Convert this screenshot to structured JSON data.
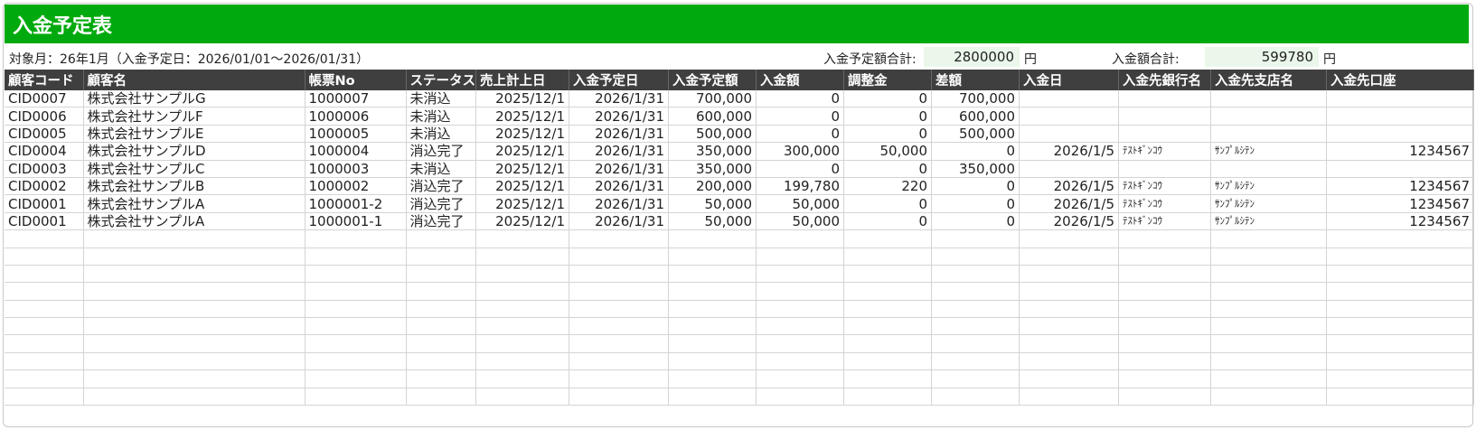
{
  "title": "入金予定表",
  "summary": {
    "period": "対象月：26年1月（入金予定日：2026/01/01～2026/01/31）",
    "planned_total_label": "入金予定額合計:",
    "planned_total_value": "2800000",
    "planned_total_unit": "円",
    "received_total_label": "入金額合計:",
    "received_total_value": "599780",
    "received_total_unit": "円"
  },
  "columns": [
    "顧客コード",
    "顧客名",
    "帳票No",
    "ステータス",
    "売上計上日",
    "入金予定日",
    "入金予定額",
    "入金額",
    "調整金",
    "差額",
    "入金日",
    "入金先銀行名",
    "入金先支店名",
    "入金先口座"
  ],
  "rows": [
    [
      "CID0007",
      "株式会社サンプルG",
      "1000007",
      "未消込",
      "2025/12/1",
      "2026/1/31",
      "700,000",
      "0",
      "0",
      "700,000",
      "",
      "",
      "",
      ""
    ],
    [
      "CID0006",
      "株式会社サンプルF",
      "1000006",
      "未消込",
      "2025/12/1",
      "2026/1/31",
      "600,000",
      "0",
      "0",
      "600,000",
      "",
      "",
      "",
      ""
    ],
    [
      "CID0005",
      "株式会社サンプルE",
      "1000005",
      "未消込",
      "2025/12/1",
      "2026/1/31",
      "500,000",
      "0",
      "0",
      "500,000",
      "",
      "",
      "",
      ""
    ],
    [
      "CID0004",
      "株式会社サンプルD",
      "1000004",
      "消込完了",
      "2025/12/1",
      "2026/1/31",
      "350,000",
      "300,000",
      "50,000",
      "0",
      "2026/1/5",
      "ﾃｽﾄｷﾞﾝｺｳ",
      "ｻﾝﾌﾟﾙｼﾃﾝ",
      "1234567"
    ],
    [
      "CID0003",
      "株式会社サンプルC",
      "1000003",
      "未消込",
      "2025/12/1",
      "2026/1/31",
      "350,000",
      "0",
      "0",
      "350,000",
      "",
      "",
      "",
      ""
    ],
    [
      "CID0002",
      "株式会社サンプルB",
      "1000002",
      "消込完了",
      "2025/12/1",
      "2026/1/31",
      "200,000",
      "199,780",
      "220",
      "0",
      "2026/1/5",
      "ﾃｽﾄｷﾞﾝｺｳ",
      "ｻﾝﾌﾟﾙｼﾃﾝ",
      "1234567"
    ],
    [
      "CID0001",
      "株式会社サンプルA",
      "1000001-2",
      "消込完了",
      "2025/12/1",
      "2026/1/31",
      "50,000",
      "50,000",
      "0",
      "0",
      "2026/1/5",
      "ﾃｽﾄｷﾞﾝｺｳ",
      "ｻﾝﾌﾟﾙｼﾃﾝ",
      "1234567"
    ],
    [
      "CID0001",
      "株式会社サンプルA",
      "1000001-1",
      "消込完了",
      "2025/12/1",
      "2026/1/31",
      "50,000",
      "50,000",
      "0",
      "0",
      "2026/1/5",
      "ﾃｽﾄｷﾞﾝｺｳ",
      "ｻﾝﾌﾟﾙｼﾃﾝ",
      "1234567"
    ]
  ]
}
